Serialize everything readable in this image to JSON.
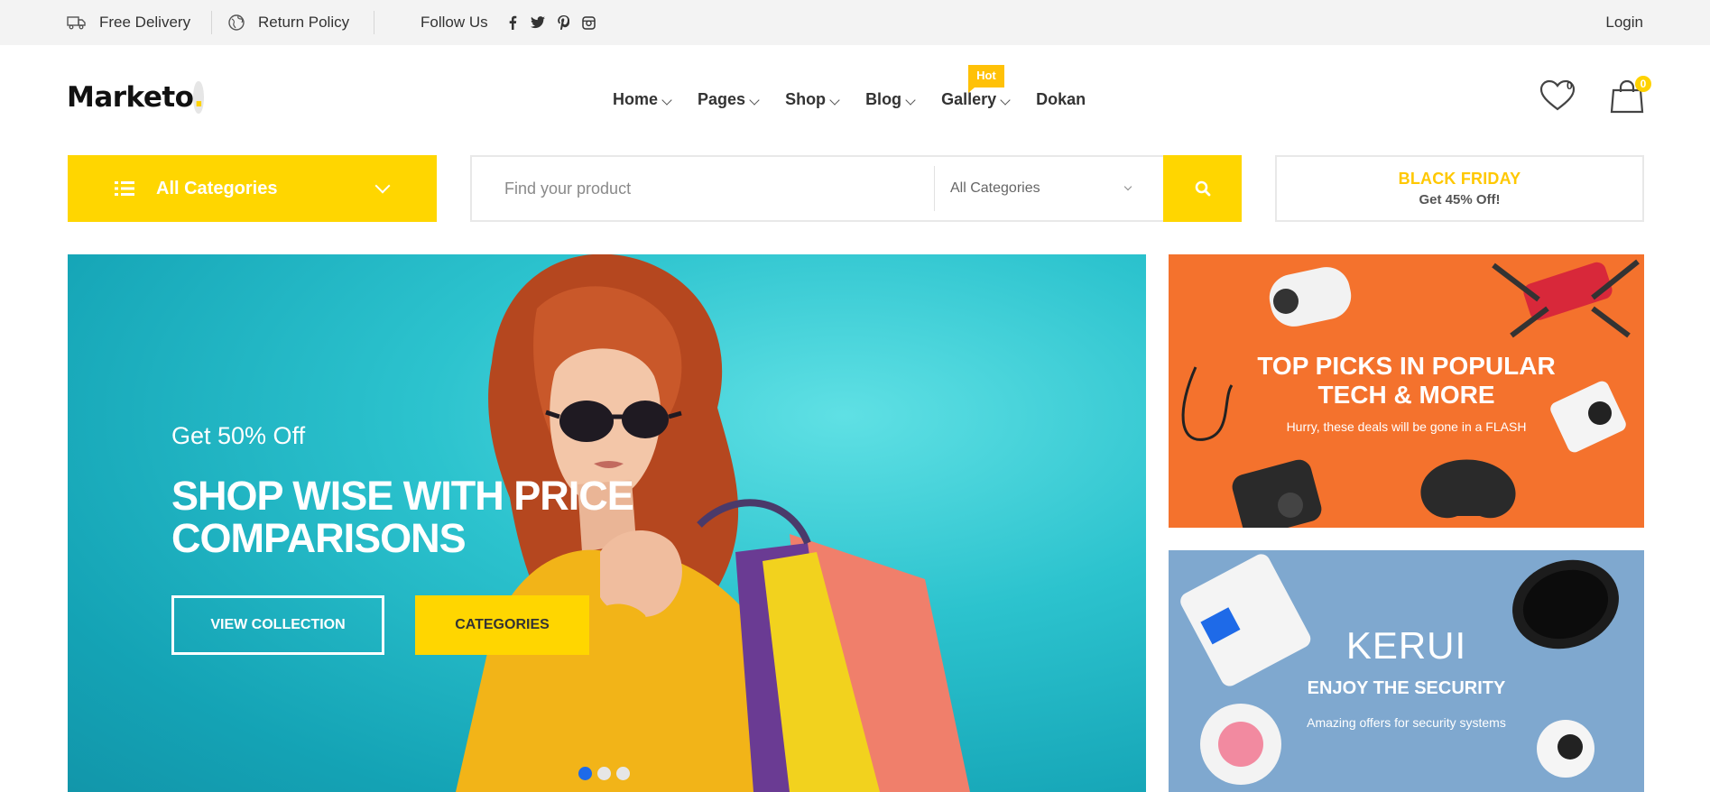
{
  "topbar": {
    "free_delivery": "Free Delivery",
    "return_policy": "Return Policy",
    "follow_us": "Follow Us",
    "social": [
      "facebook-icon",
      "twitter-icon",
      "pinterest-icon",
      "instagram-icon"
    ],
    "login": "Login"
  },
  "header": {
    "logo_text": "Marketo",
    "logo_dot": ".",
    "nav": [
      {
        "label": "Home"
      },
      {
        "label": "Pages"
      },
      {
        "label": "Shop"
      },
      {
        "label": "Blog"
      },
      {
        "label": "Gallery",
        "badge": "Hot"
      },
      {
        "label": "Dokan"
      }
    ],
    "wishlist_count": "0",
    "cart_count": "0"
  },
  "search": {
    "categories_button": "All Categories",
    "placeholder": "Find your product",
    "category_select": "All Categories"
  },
  "promo": {
    "title": "BLACK FRIDAY",
    "subtitle": "Get 45% Off!"
  },
  "hero": {
    "kicker": "Get 50% Off",
    "title": "SHOP WISE WITH PRICE COMPARISONS",
    "button_primary": "VIEW COLLECTION",
    "button_secondary": "CATEGORIES",
    "slides": 3,
    "active_slide": 1
  },
  "banners": {
    "tech_title_line1": "TOP PICKS IN POPULAR",
    "tech_title_line2": "TECH & MORE",
    "tech_sub": "Hurry, these deals will be gone in a FLASH",
    "security_brand": "KERUI",
    "security_title": "ENJOY THE SECURITY",
    "security_sub": "Amazing offers for security systems"
  },
  "colors": {
    "accent": "#ffd600",
    "badge": "#ffc107",
    "hero_bg": "#2cc3ce",
    "banner_orange": "#f4722d",
    "banner_blue": "#7fa8cf",
    "slider_active": "#1e6ae8"
  }
}
